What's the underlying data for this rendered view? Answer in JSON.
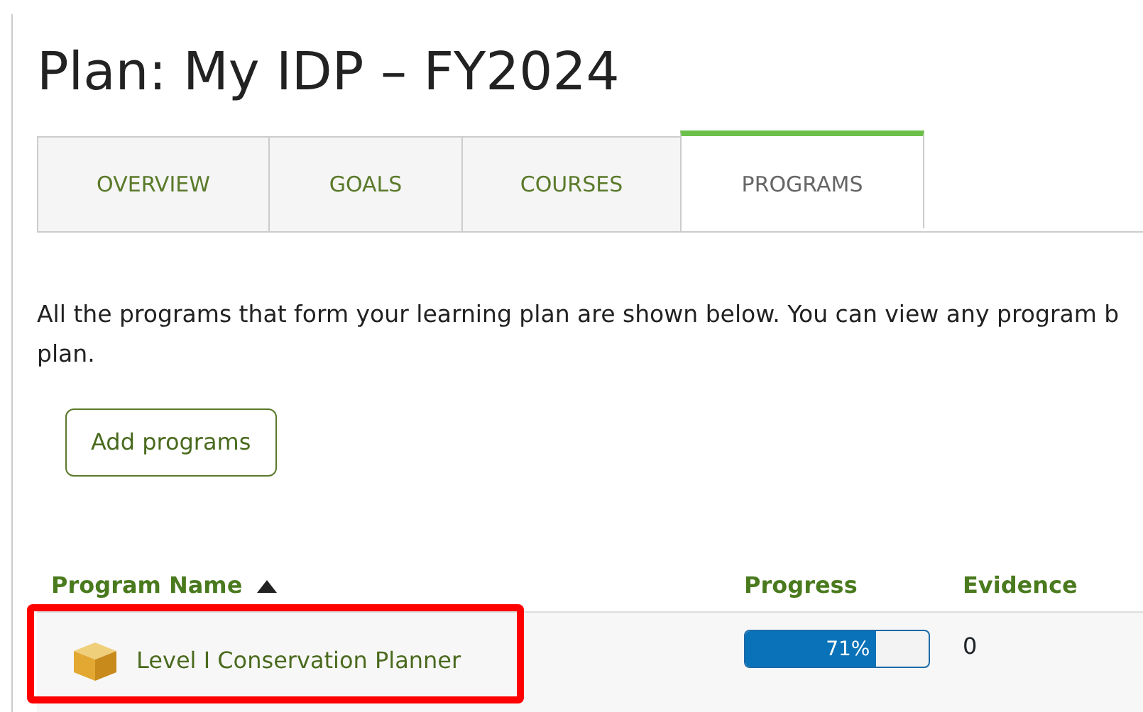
{
  "title": "Plan: My IDP – FY2024",
  "tabs": [
    {
      "label": "OVERVIEW",
      "selected": false
    },
    {
      "label": "GOALS",
      "selected": false
    },
    {
      "label": "COURSES",
      "selected": false
    },
    {
      "label": "PROGRAMS",
      "selected": true
    }
  ],
  "description_lines": [
    "All the programs that form your learning plan are shown below. You can view any program b",
    "plan."
  ],
  "add_button": "Add programs",
  "table": {
    "columns": [
      {
        "label": "Program Name",
        "sorted_ascending": true
      },
      {
        "label": "Progress"
      },
      {
        "label": "Evidence"
      }
    ],
    "rows": [
      {
        "name": "Level I Conservation Planner",
        "highlighted": true,
        "progress": {
          "level": 0.71,
          "reading": "71%"
        },
        "evidence": "0"
      }
    ]
  }
}
